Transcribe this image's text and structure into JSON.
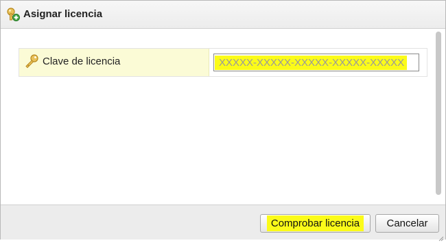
{
  "dialog": {
    "title": "Asignar licencia",
    "title_icon": "key-add-icon"
  },
  "form": {
    "label": "Clave de licencia",
    "label_icon": "key-icon",
    "value": "XXXXX-XXXXX-XXXXX-XXXXX-XXXXX"
  },
  "footer": {
    "check_label": "Comprobar licencia",
    "cancel_label": "Cancelar"
  },
  "colors": {
    "highlight": "#fbfb19",
    "label_cell": "#fbfbd6"
  }
}
